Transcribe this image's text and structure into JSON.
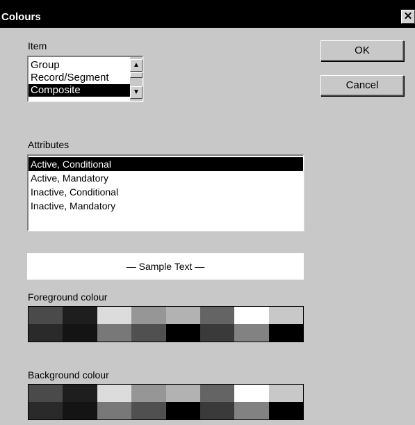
{
  "window": {
    "title": "Colours",
    "close_glyph": "✕"
  },
  "item": {
    "label": "Item",
    "options": [
      "Group",
      "Record/Segment",
      "Composite"
    ],
    "selected_index": 2
  },
  "buttons": {
    "ok": "OK",
    "cancel": "Cancel"
  },
  "attributes": {
    "label": "Attributes",
    "options": [
      "Active, Conditional",
      "Active, Mandatory",
      "Inactive, Conditional",
      "Inactive, Mandatory"
    ],
    "selected_index": 0
  },
  "sample": {
    "text": "— Sample Text —"
  },
  "foreground": {
    "label": "Foreground colour",
    "colors": [
      "#4a4a4a",
      "#1e1e1e",
      "#dcdcdc",
      "#969696",
      "#b2b2b2",
      "#646464",
      "#ffffff",
      "#c8c8c8",
      "#2a2a2a",
      "#141414",
      "#787878",
      "#505050",
      "#000000",
      "#3a3a3a",
      "#828282",
      "#000000"
    ]
  },
  "background": {
    "label": "Background colour",
    "colors": [
      "#4a4a4a",
      "#1e1e1e",
      "#dcdcdc",
      "#969696",
      "#b2b2b2",
      "#646464",
      "#ffffff",
      "#c8c8c8",
      "#2a2a2a",
      "#141414",
      "#787878",
      "#505050",
      "#000000",
      "#3a3a3a",
      "#828282",
      "#000000"
    ]
  }
}
